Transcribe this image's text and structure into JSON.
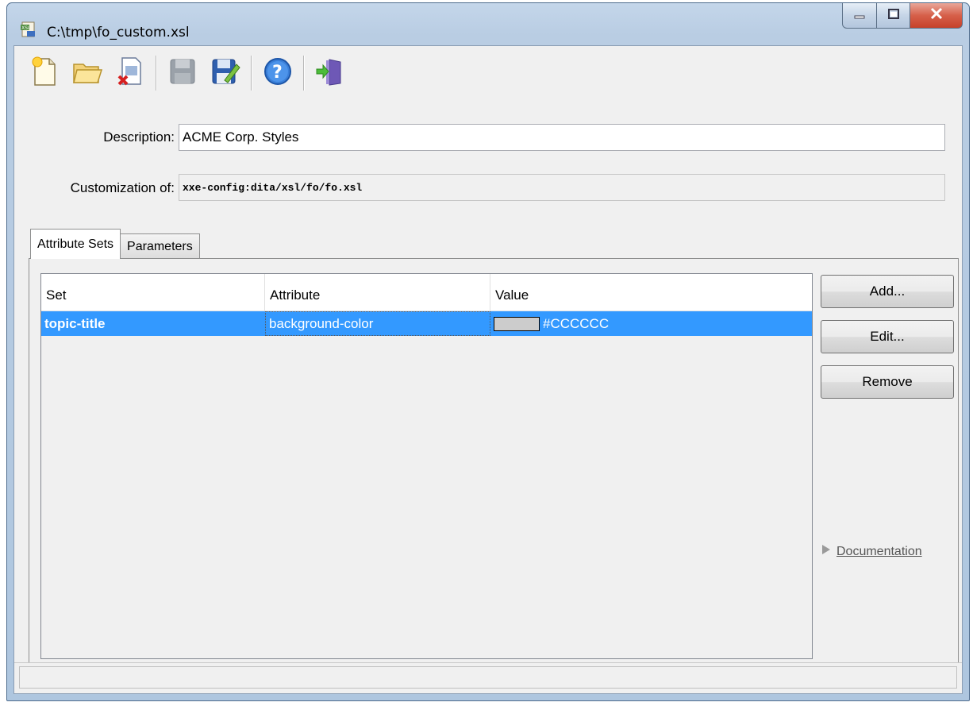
{
  "window": {
    "title": "C:\\tmp\\fo_custom.xsl"
  },
  "toolbar": {
    "buttons": [
      {
        "icon": "new-document-icon"
      },
      {
        "icon": "open-folder-icon"
      },
      {
        "icon": "close-document-icon"
      },
      {
        "icon": "save-icon"
      },
      {
        "icon": "save-as-icon"
      },
      {
        "icon": "help-icon"
      },
      {
        "icon": "exit-icon"
      }
    ]
  },
  "form": {
    "description_label": "Description:",
    "description_value": "ACME Corp. Styles",
    "customization_label": "Customization of:",
    "customization_value": "xxe-config:dita/xsl/fo/fo.xsl"
  },
  "tabs": [
    {
      "label": "Attribute Sets",
      "active": true
    },
    {
      "label": "Parameters",
      "active": false
    }
  ],
  "table": {
    "columns": [
      "Set",
      "Attribute",
      "Value"
    ],
    "rows": [
      {
        "set": "topic-title",
        "attribute": "background-color",
        "value": "#CCCCCC",
        "swatch_color": "#cccccc",
        "selected": true
      }
    ]
  },
  "buttons": {
    "add": "Add...",
    "edit": "Edit...",
    "remove": "Remove"
  },
  "documentation_label": "Documentation",
  "colors": {
    "selection": "#3399ff",
    "title_bar": "#b9cde3",
    "close_button": "#c7412a"
  }
}
